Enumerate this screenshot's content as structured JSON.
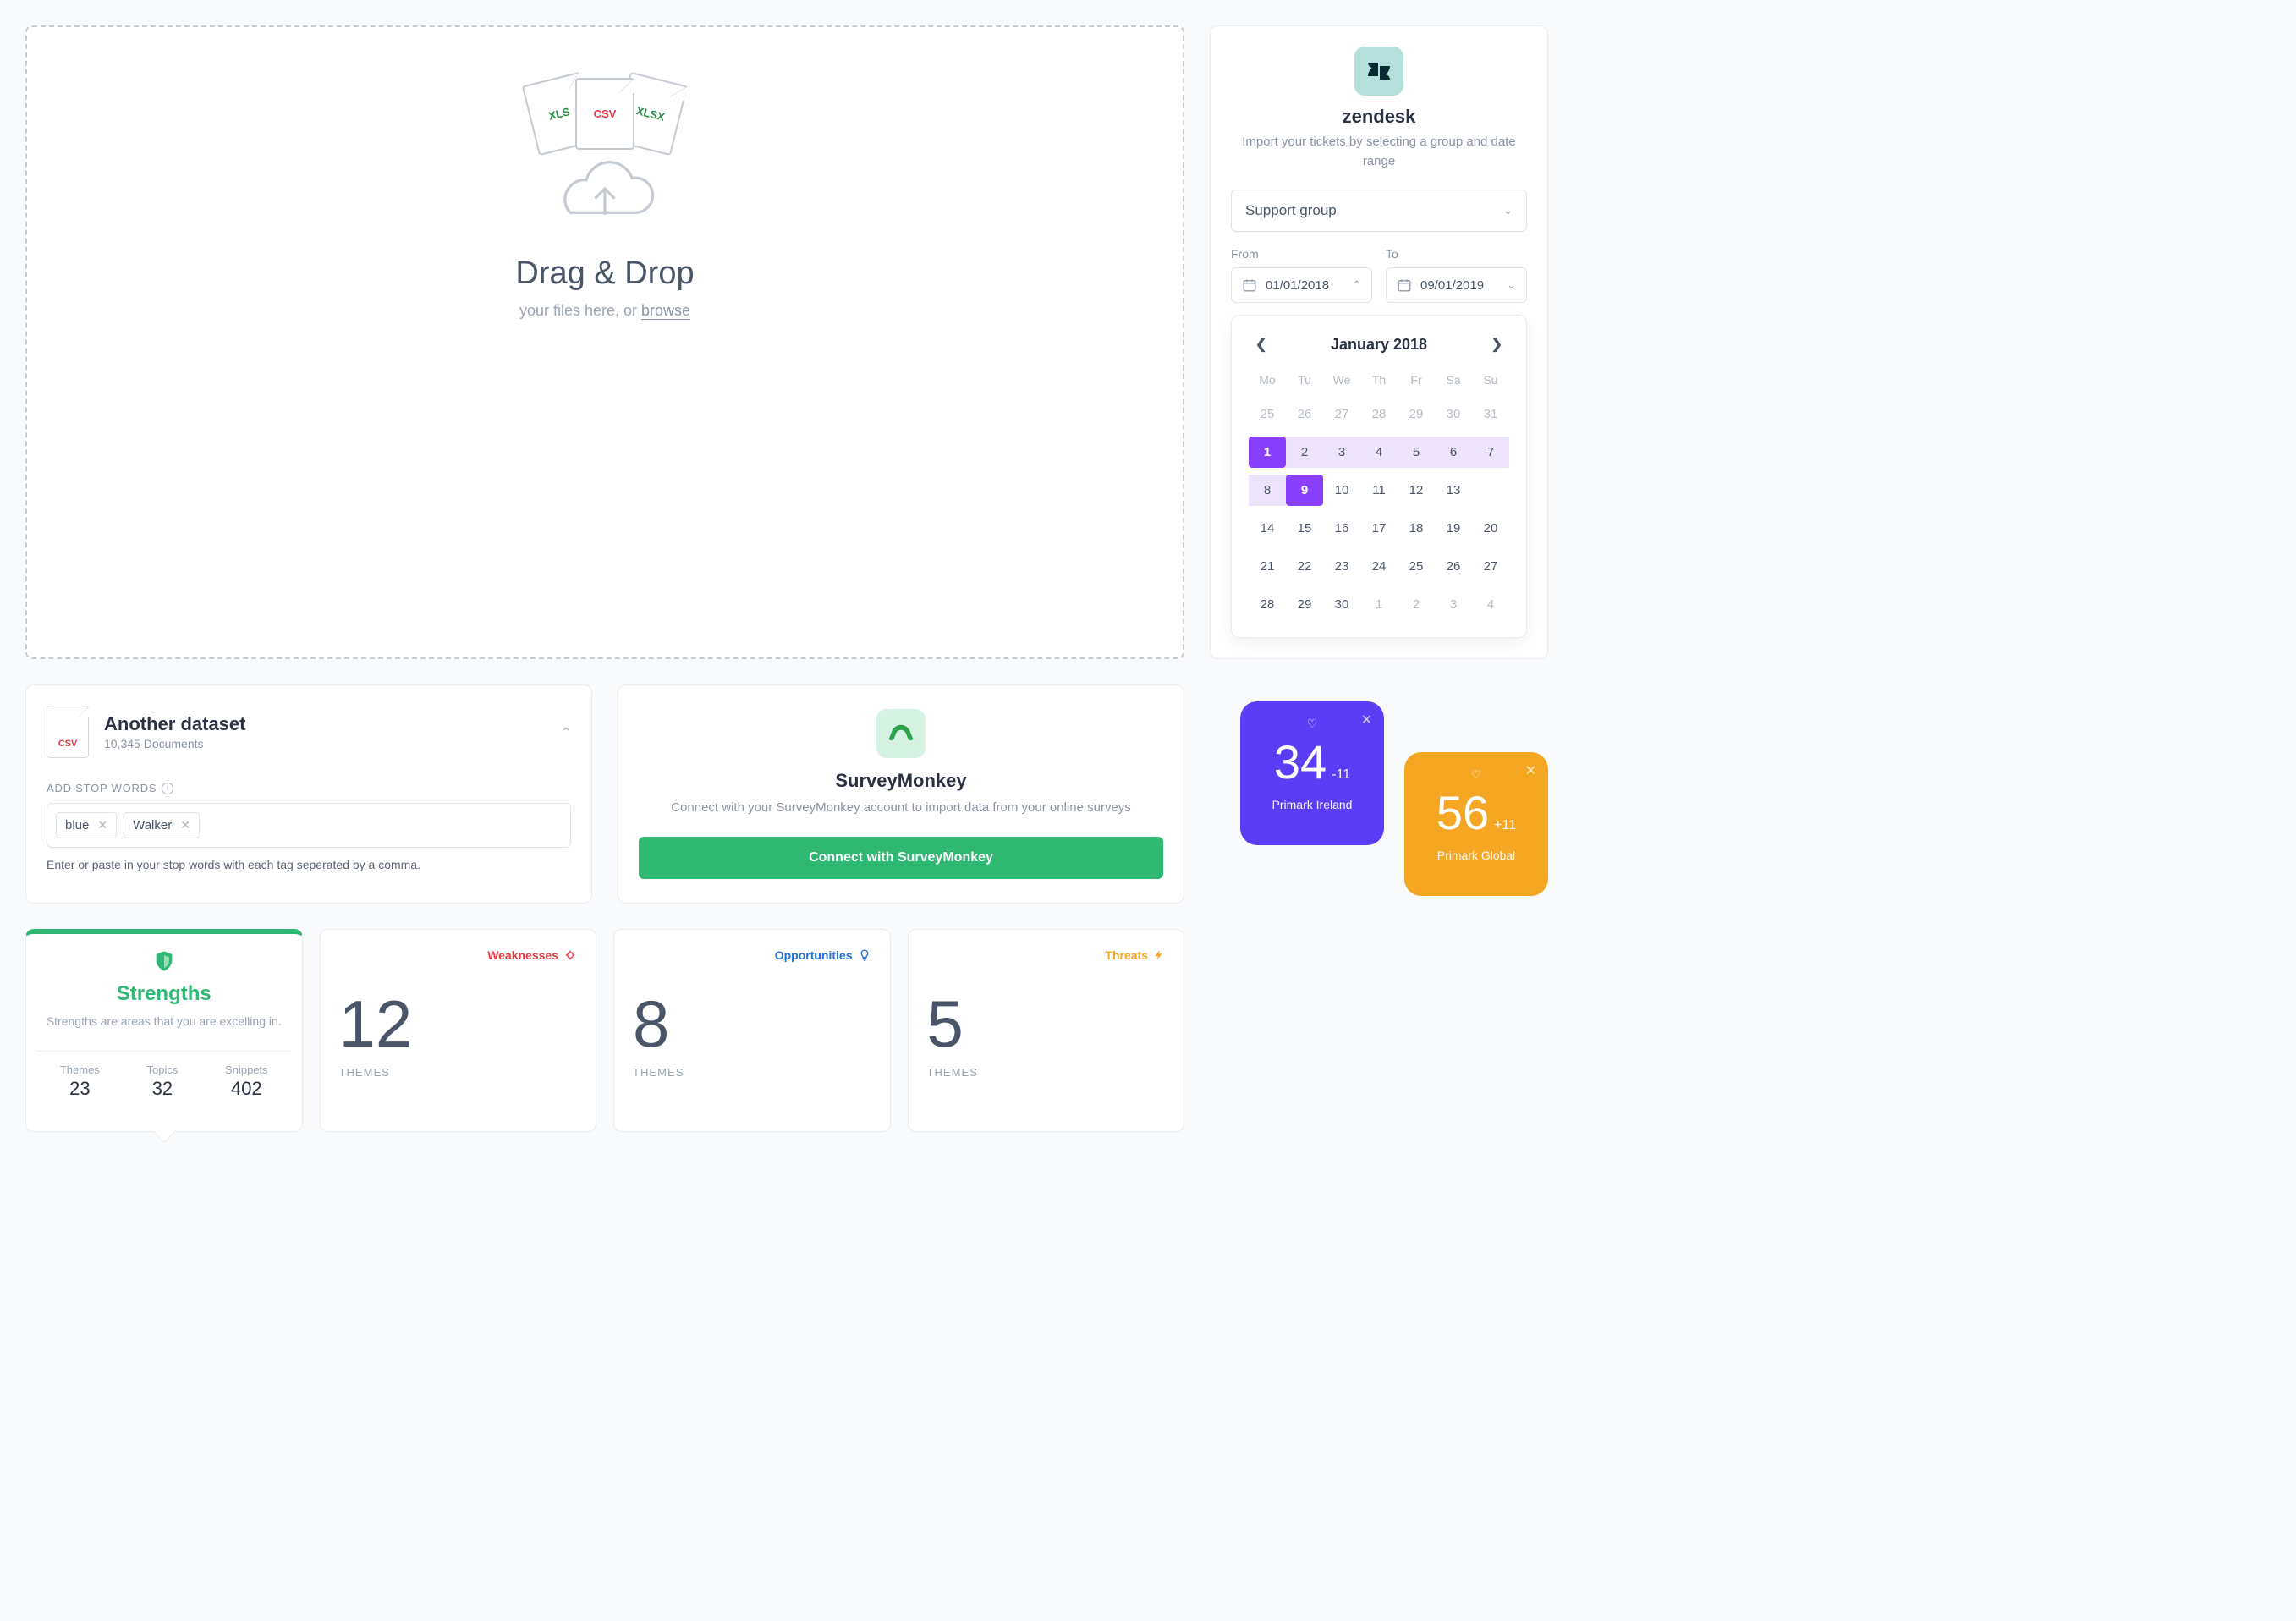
{
  "drop": {
    "title": "Drag & Drop",
    "subtitle_prefix": "your files here, or ",
    "browse": "browse",
    "file_types": [
      "XLS",
      "CSV",
      "XLSX"
    ]
  },
  "zendesk": {
    "title": "zendesk",
    "desc": "Import your tickets by selecting a group and date range",
    "group_placeholder": "Support group",
    "from_label": "From",
    "to_label": "To",
    "from_value": "01/01/2018",
    "to_value": "09/01/2019"
  },
  "calendar": {
    "month_label": "January 2018",
    "weekdays": [
      "Mo",
      "Tu",
      "We",
      "Th",
      "Fr",
      "Sa",
      "Su"
    ],
    "rows": [
      [
        {
          "n": 25,
          "m": true
        },
        {
          "n": 26,
          "m": true
        },
        {
          "n": 27,
          "m": true
        },
        {
          "n": 28,
          "m": true
        },
        {
          "n": 29,
          "m": true
        },
        {
          "n": 30,
          "m": true
        },
        {
          "n": 31,
          "m": true
        }
      ],
      [
        {
          "n": 1,
          "sel": true
        },
        {
          "n": 2,
          "r": true
        },
        {
          "n": 3,
          "r": true
        },
        {
          "n": 4,
          "r": true
        },
        {
          "n": 5,
          "r": true
        },
        {
          "n": 6,
          "r": true
        },
        {
          "n": 7,
          "r": true
        }
      ],
      [
        {
          "n": 8,
          "r": true
        },
        {
          "n": 9,
          "sel": true
        },
        {
          "n": 10
        },
        {
          "n": 11
        },
        {
          "n": 12
        },
        {
          "n": 13
        }
      ],
      [
        {
          "n": 14
        },
        {
          "n": 15
        },
        {
          "n": 16
        },
        {
          "n": 17
        },
        {
          "n": 18
        },
        {
          "n": 19
        },
        {
          "n": 20
        }
      ],
      [
        {
          "n": 21
        },
        {
          "n": 22
        },
        {
          "n": 23
        },
        {
          "n": 24
        },
        {
          "n": 25
        },
        {
          "n": 26
        },
        {
          "n": 27
        }
      ],
      [
        {
          "n": 28
        },
        {
          "n": 29
        },
        {
          "n": 30
        },
        {
          "n": 1,
          "m": true
        },
        {
          "n": 2,
          "m": true
        },
        {
          "n": 3,
          "m": true
        },
        {
          "n": 4,
          "m": true
        }
      ]
    ]
  },
  "dataset": {
    "file_badge": "CSV",
    "title": "Another dataset",
    "count": "10,345 Documents",
    "stop_words_label": "ADD STOP WORDS",
    "tags": [
      "blue",
      "Walker"
    ],
    "help": "Enter or paste in your stop words with each tag seperated by a comma."
  },
  "surveymonkey": {
    "title": "SurveyMonkey",
    "desc": "Connect with your SurveyMonkey account to import data from your online surveys",
    "button": "Connect with SurveyMonkey"
  },
  "swot": {
    "strengths": {
      "title": "Strengths",
      "desc": "Strengths are areas that you are excelling in.",
      "stats": [
        {
          "label": "Themes",
          "value": "23"
        },
        {
          "label": "Topics",
          "value": "32"
        },
        {
          "label": "Snippets",
          "value": "402"
        }
      ]
    },
    "weaknesses": {
      "label": "Weaknesses",
      "value": "12",
      "unit": "THEMES"
    },
    "opportunities": {
      "label": "Opportunities",
      "value": "8",
      "unit": "THEMES"
    },
    "threats": {
      "label": "Threats",
      "value": "5",
      "unit": "THEMES"
    }
  },
  "tiles": [
    {
      "value": "34",
      "delta": "-11",
      "name": "Primark Ireland",
      "color": "purple"
    },
    {
      "value": "56",
      "delta": "+11",
      "name": "Primark Global",
      "color": "orange"
    }
  ]
}
